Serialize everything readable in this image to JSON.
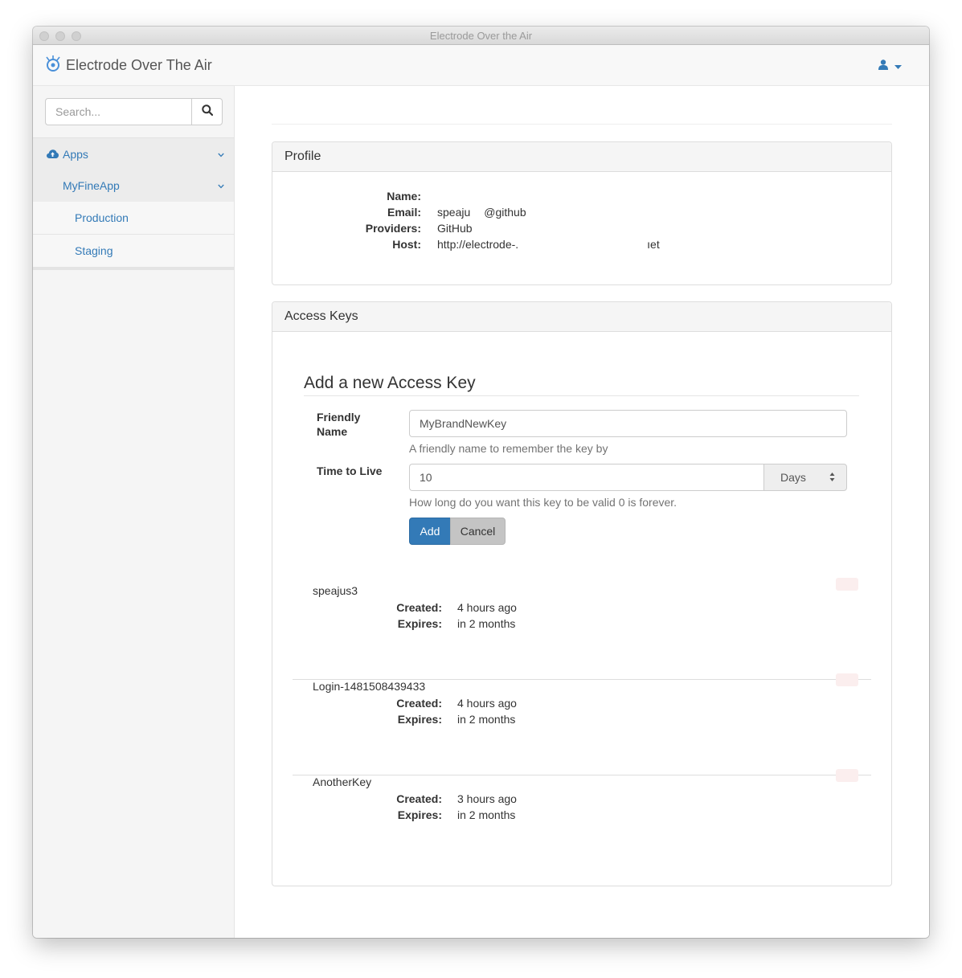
{
  "window": {
    "title": "Electrode Over the Air"
  },
  "navbar": {
    "brand": "Electrode Over The Air",
    "user_icon": "user-icon"
  },
  "sidebar": {
    "search_placeholder": "Search...",
    "apps_label": "Apps",
    "app_label": "MyFineApp",
    "deployments": [
      "Production",
      "Staging"
    ]
  },
  "profile": {
    "heading": "Profile",
    "labels": {
      "name": "Name:",
      "email": "Email:",
      "providers": "Providers:",
      "host": "Host:"
    },
    "values": {
      "name": "",
      "email_user": "speaju",
      "email_domain": "@github",
      "providers": "GitHub",
      "host_start": "http://electrode-.",
      "host_end": "ıet"
    }
  },
  "access_keys": {
    "heading": "Access Keys",
    "form": {
      "title": "Add a new Access Key",
      "friendly_name_label_line1": "Friendly",
      "friendly_name_label_line2": "Name",
      "friendly_name_value": "MyBrandNewKey",
      "friendly_name_help": "A friendly name to remember the key by",
      "ttl_label": "Time to Live",
      "ttl_value": "10",
      "ttl_unit": "Days",
      "ttl_help": "How long do you want this key to be valid 0 is forever.",
      "add_label": "Add",
      "cancel_label": "Cancel"
    },
    "created_label": "Created:",
    "expires_label": "Expires:",
    "keys": [
      {
        "name": "speajus3",
        "created": "4 hours ago",
        "expires": "in 2 months"
      },
      {
        "name": "Login-1481508439433",
        "created": "4 hours ago",
        "expires": "in 2 months"
      },
      {
        "name": "AnotherKey",
        "created": "3 hours ago",
        "expires": "in 2 months"
      }
    ]
  },
  "colors": {
    "link": "#337ab7",
    "primary": "#337ab7"
  }
}
